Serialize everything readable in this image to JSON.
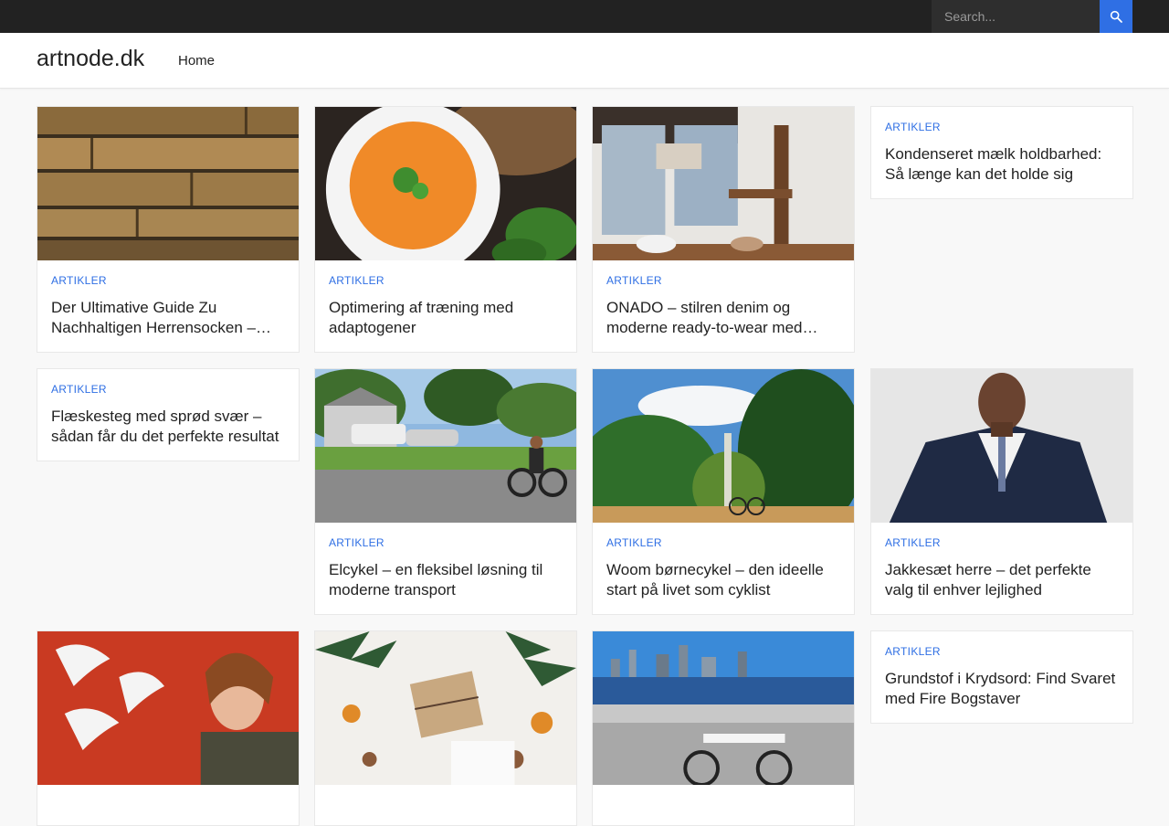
{
  "search": {
    "placeholder": "Search..."
  },
  "header": {
    "site_title": "artnode.dk",
    "nav_home": "Home"
  },
  "colors": {
    "accent": "#2f6fe4",
    "topbar": "#222222"
  },
  "posts": [
    {
      "category": "ARTIKLER",
      "title": "Der Ultimative Guide Zu Nachhaltigen Herrensocken – Komfort, Stil und Umweltbewusstsein"
    },
    {
      "category": "ARTIKLER",
      "title": "Optimering af træning med adaptogener"
    },
    {
      "category": "ARTIKLER",
      "title": "ONADO – stilren denim og moderne ready-to-wear med fransk elegance"
    },
    {
      "category": "ARTIKLER",
      "title": "Kondenseret mælk holdbarhed: Så længe kan det holde sig"
    },
    {
      "category": "ARTIKLER",
      "title": "Flæskesteg med sprød svær – sådan får du det perfekte resultat"
    },
    {
      "category": "ARTIKLER",
      "title": "Elcykel – en fleksibel løsning til moderne transport"
    },
    {
      "category": "ARTIKLER",
      "title": "Woom børnecykel – den ideelle start på livet som cyklist"
    },
    {
      "category": "ARTIKLER",
      "title": "Jakkesæt herre – det perfekte valg til enhver lejlighed"
    },
    {
      "category": "ARTIKLER",
      "title": "Grundstof i Krydsord: Find Svaret med Fire Bogstaver"
    }
  ]
}
